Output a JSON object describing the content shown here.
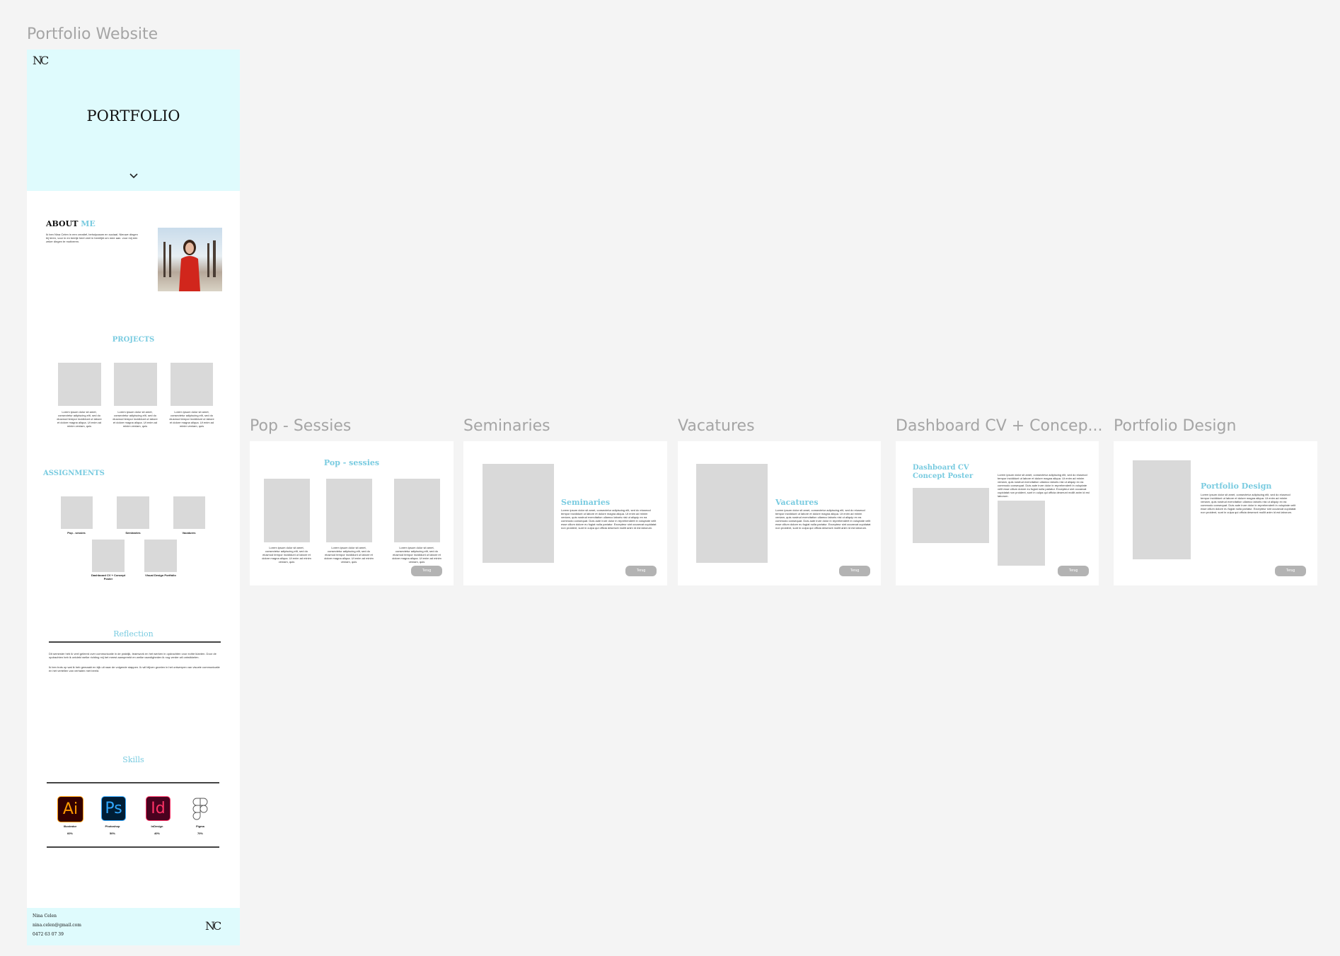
{
  "canvas": {
    "frames": [
      {
        "title": "Portfolio Website"
      },
      {
        "title": "Pop - Sessies"
      },
      {
        "title": "Seminaries"
      },
      {
        "title": "Vacatures"
      },
      {
        "title": "Dashboard CV + Concep..."
      },
      {
        "title": "Portfolio Design"
      }
    ]
  },
  "portfolio": {
    "logo": "NC",
    "hero_title": "PORTFOLIO",
    "about": {
      "title_a": "ABOUT",
      "title_b": "ME",
      "text": "Ik ben Nina Celen in een creatief, behulpzaam en sociaal. Nieuwe dingen bij leren, voor in en beetje heel veel in heerlijkt om mee aan. voor mij een zeker dingen te motiveren."
    },
    "projects": {
      "title": "PROJECTS",
      "captions": [
        "Lorem ipsum dolor sit amet, consectetur adipiscing elit, sed do eiusmod tempor incididunt ut labore et dolore magna aliqua. Ut enim ad minim veniam, quis",
        "Lorem ipsum dolor sit amet, consectetur adipiscing elit, sed do eiusmod tempor incididunt ut labore et dolore magna aliqua. Ut enim ad minim veniam, quis",
        "Lorem ipsum dolor sit amet, consectetur adipiscing elit, sed do eiusmod tempor incididunt ut labore et dolore magna aliqua. Ut enim ad minim veniam, quis"
      ]
    },
    "assignments": {
      "title": "ASSIGNMENTS",
      "items": [
        "Pop - sessies",
        "Seminaries",
        "Vacatures",
        "Dashboard CV + Concept Poster",
        "Visual Design Portfolio"
      ]
    },
    "reflection": {
      "title": "Reflection",
      "p1": "Dit semester heb ik veel geleerd over communicatie in de praktijk, teamwork en het werken in opdrachten voor echte klanten. Door de opdrachten heb ik ontdekt welke richting mij het meest aanspreekt en welke vaardigheden ik nog verder wil ontwikkelen.",
      "p2": "Ik ben trots op wat ik heb gemaakt en kijk uit naar de volgende stappen. Ik wil blijven groeien in het ontwerpen van visuele communicatie en het vertellen van verhalen met beeld."
    },
    "skills": {
      "title": "Skills",
      "items": [
        {
          "icon": "Ai",
          "name": "Illustrator",
          "percent": "60%"
        },
        {
          "icon": "Ps",
          "name": "Photoshop",
          "percent": "50%"
        },
        {
          "icon": "Id",
          "name": "InDesign",
          "percent": "40%"
        },
        {
          "icon": "figma",
          "name": "Figma",
          "percent": "70%"
        }
      ]
    },
    "footer": {
      "name": "Nina Celen",
      "email": "nina.celen@gmail.com",
      "phone": "0472 63 07 39",
      "logo": "NC"
    }
  },
  "pop": {
    "title": "Pop - sessies",
    "captions": [
      "Lorem ipsum dolor sit amet, consectetur adipiscing elit, sed do eiusmod tempor incididunt ut labore et dolore magna aliqua. Ut enim ad minim veniam, quis",
      "Lorem ipsum dolor sit amet, consectetur adipiscing elit, sed do eiusmod tempor incididunt ut labore et dolore magna aliqua. Ut enim ad minim veniam, quis",
      "Lorem ipsum dolor sit amet, consectetur adipiscing elit, sed do eiusmod tempor incididunt ut labore et dolore magna aliqua. Ut enim ad minim veniam, quis"
    ],
    "back": "Terug"
  },
  "seminaries": {
    "title": "Seminaries",
    "text": "Lorem ipsum dolor sit amet, consectetur adipiscing elit, sed do eiusmod tempor incididunt ut labore et dolore magna aliqua. Ut enim ad minim veniam, quis nostrud exercitation ullamco laboris nisi ut aliquip ex ea commodo consequat. Duis aute irure dolor in reprehenderit in voluptate velit esse cillum dolore eu fugiat nulla pariatur. Excepteur sint occaecat cupidatat non proident, sunt in culpa qui officia deserunt mollit anim id est laborum.",
    "back": "Terug"
  },
  "vacatures": {
    "title": "Vacatures",
    "text": "Lorem ipsum dolor sit amet, consectetur adipiscing elit, sed do eiusmod tempor incididunt ut labore et dolore magna aliqua. Ut enim ad minim veniam, quis nostrud exercitation ullamco laboris nisi ut aliquip ex ea commodo consequat. Duis aute irure dolor in reprehenderit in voluptate velit esse cillum dolore eu fugiat nulla pariatur. Excepteur sint occaecat cupidatat non proident, sunt in culpa qui officia deserunt mollit anim id est laborum.",
    "back": "Terug"
  },
  "dashboard": {
    "title_line1": "Dashboard CV",
    "title_line2": "Concept Poster",
    "text": "Lorem ipsum dolor sit amet, consectetur adipiscing elit, sed do eiusmod tempor incididunt ut labore et dolore magna aliqua. Ut enim ad minim veniam, quis nostrud exercitation ullamco laboris nisi ut aliquip ex ea commodo consequat. Duis aute irure dolor in reprehenderit in voluptate velit esse cillum dolore eu fugiat nulla pariatur. Excepteur sint occaecat cupidatat non proident, sunt in culpa qui officia deserunt mollit anim id est laborum.",
    "back": "Terug"
  },
  "portfolio_design": {
    "title": "Portfolio Design",
    "text": "Lorem ipsum dolor sit amet, consectetur adipiscing elit, sed do eiusmod tempor incididunt ut labore et dolore magna aliqua. Ut enim ad minim veniam, quis nostrud exercitation ullamco laboris nisi ut aliquip ex ea commodo consequat. Duis aute irure dolor in reprehenderit in voluptate velit esse cillum dolore eu fugiat nulla pariatur. Excepteur sint occaecat cupidatat non proident, sunt in culpa qui officia deserunt mollit anim id est laborum.",
    "back": "Terug"
  },
  "colors": {
    "canvas": "#f4f4f4",
    "hero": "#dffbfd",
    "accent": "#79cbe0",
    "placeholder": "#d9d9d9",
    "button": "#b3b3b3"
  }
}
